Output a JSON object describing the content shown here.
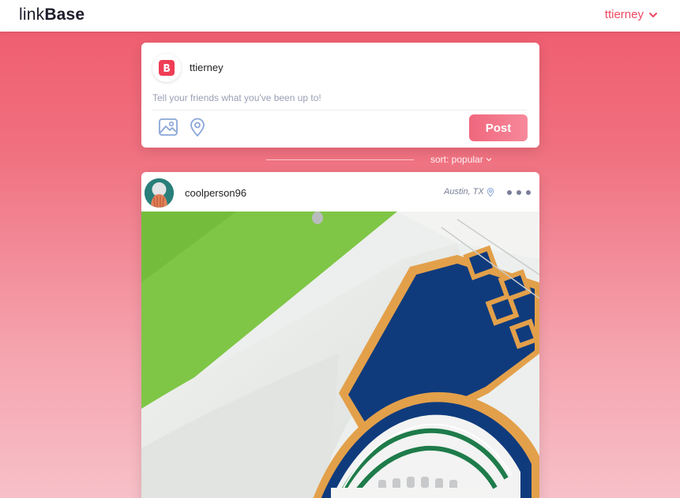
{
  "app": {
    "logo_light": "link",
    "logo_bold": "Base"
  },
  "header": {
    "username": "ttierney",
    "menu_icon": "chevron-down-icon"
  },
  "composer": {
    "avatar_icon": "brand-b-icon",
    "username": "ttierney",
    "placeholder": "Tell your friends what you've been up to!",
    "value": "",
    "image_icon": "image-icon",
    "location_icon": "location-pin-icon",
    "post_label": "Post"
  },
  "feed": {
    "sort_label": "sort: popular",
    "sort_icon": "chevron-down-icon"
  },
  "post": {
    "username": "coolperson96",
    "location": "Austin, TX",
    "location_icon": "location-pin-icon",
    "more_icon": "more-dots-icon",
    "image_icon": "architecture-photo"
  },
  "colors": {
    "accent": "#ef4a62",
    "brand_red": "#ef3e55",
    "icon_blue": "#8aa6d8",
    "muted_text": "#9aa0b4"
  }
}
